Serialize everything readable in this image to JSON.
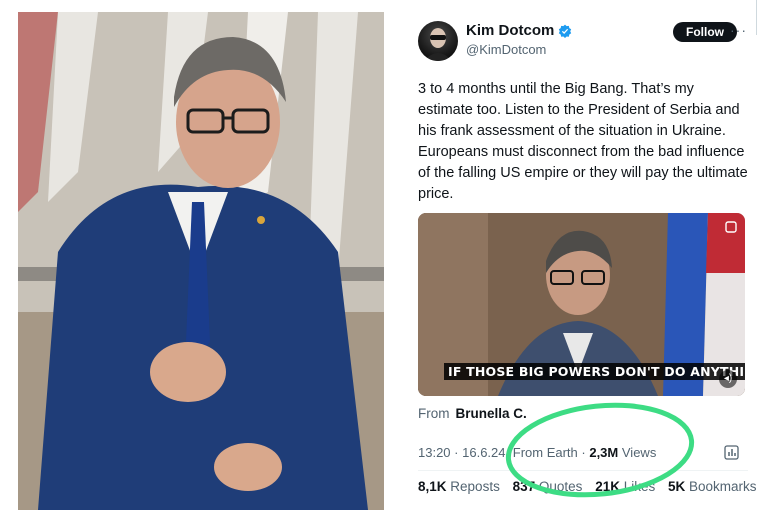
{
  "tweet": {
    "display_name": "Kim Dotcom",
    "handle": "@KimDotcom",
    "follow_label": "Follow",
    "more_label": "···",
    "text": "3 to 4 months until the Big Bang. That’s my estimate too. Listen to the President of Serbia and his frank assessment of the situation in Ukraine. Europeans must disconnect from the bad influence of the falling US empire or they will pay the ultimate price.",
    "video": {
      "caption": "IF THOSE BIG POWERS DON'T DO ANYTHING IN A"
    },
    "from_label": "From",
    "from_name": "Brunella C.",
    "meta": {
      "time": "13:20",
      "date": "16.6.24.",
      "location": "From Earth",
      "views_value": "2,3M",
      "views_label": "Views"
    },
    "stats": [
      {
        "value": "8,1K",
        "label": "Reposts"
      },
      {
        "value": "837",
        "label": "Quotes"
      },
      {
        "value": "21K",
        "label": "Likes"
      },
      {
        "value": "5K",
        "label": "Bookmarks"
      }
    ]
  },
  "colors": {
    "highlight_circle": "#3ddc84",
    "verified": "#1d9bf0",
    "muted_text": "#536471"
  },
  "icons": [
    "verified-badge-icon",
    "volume-icon",
    "settings-icon",
    "analytics-icon"
  ]
}
